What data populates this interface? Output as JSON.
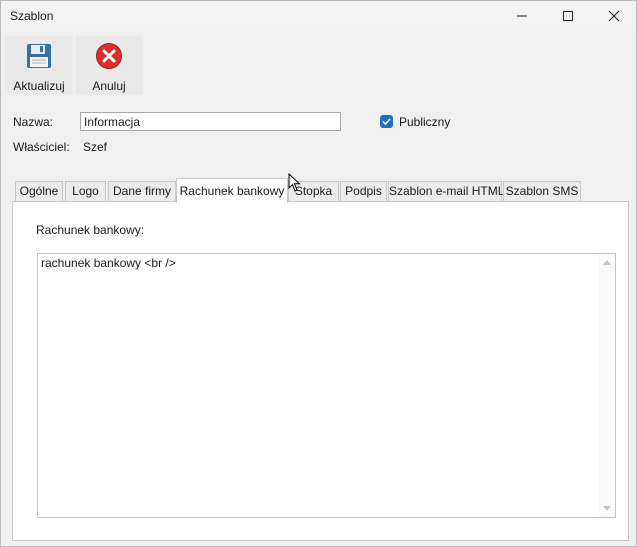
{
  "window": {
    "title": "Szablon",
    "controls": {
      "minimize": "minimize-icon",
      "maximize": "maximize-icon",
      "close": "close-icon"
    }
  },
  "toolbar": {
    "update_label": "Aktualizuj",
    "update_icon": "floppy-disk-icon",
    "cancel_label": "Anuluj",
    "cancel_icon": "red-x-icon"
  },
  "form": {
    "name_label": "Nazwa:",
    "name_value": "Informacja",
    "public_label": "Publiczny",
    "public_checked": true,
    "owner_label": "Właściciel:",
    "owner_value": "Szef"
  },
  "tabs": [
    {
      "label": "Ogólne"
    },
    {
      "label": "Logo"
    },
    {
      "label": "Dane firmy"
    },
    {
      "label": "Rachunek bankowy",
      "active": true
    },
    {
      "label": "Stopka"
    },
    {
      "label": "Podpis"
    },
    {
      "label": "Szablon e-mail HTML"
    },
    {
      "label": "Szablon SMS"
    }
  ],
  "panel": {
    "label": "Rachunek bankowy:",
    "content": "rachunek bankowy <br />"
  },
  "colors": {
    "accent": "#1f6fc5",
    "cancel_red": "#d9302c"
  }
}
